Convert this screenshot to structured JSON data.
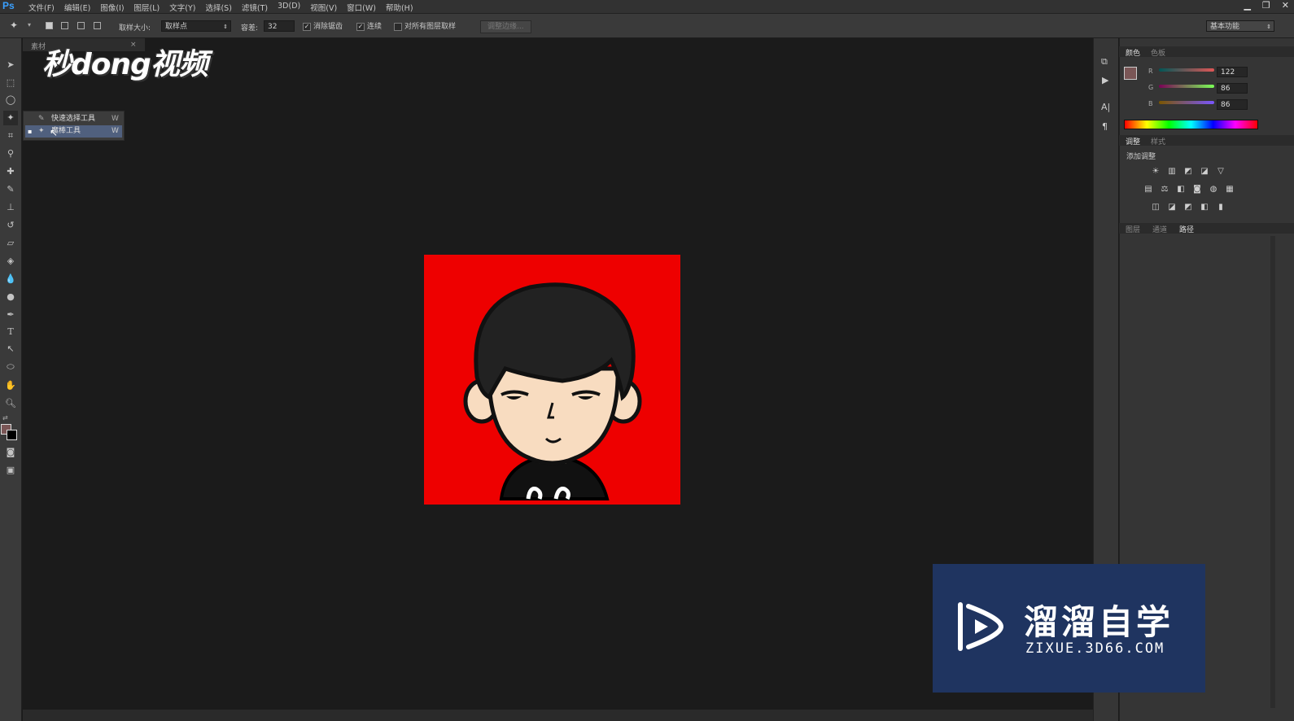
{
  "app": {
    "logo": "Ps"
  },
  "menu": [
    "文件(F)",
    "编辑(E)",
    "图像(I)",
    "图层(L)",
    "文字(Y)",
    "选择(S)",
    "滤镜(T)",
    "3D(D)",
    "视图(V)",
    "窗口(W)",
    "帮助(H)"
  ],
  "window_controls": {
    "minimize": "▁",
    "restore": "❐",
    "close": "✕"
  },
  "options": {
    "sample_size_label": "取样大小:",
    "sample_size_value": "取样点",
    "tolerance_label": "容差:",
    "tolerance_value": "32",
    "antialias_label": "消除锯齿",
    "antialias_checked": true,
    "contiguous_label": "连续",
    "contiguous_checked": true,
    "sample_all_label": "对所有图层取样",
    "sample_all_checked": false,
    "refine_edge_label": "调整边缘...",
    "workspace": "基本功能"
  },
  "doc_tab": {
    "title": "素材",
    "close": "×"
  },
  "watermark_top": "秒dong视频",
  "tool_flyout": [
    {
      "label": "快速选择工具",
      "shortcut": "W",
      "selected": false
    },
    {
      "label": "魔棒工具",
      "shortcut": "W",
      "selected": true
    }
  ],
  "panels": {
    "color_tabs": [
      "颜色",
      "色板"
    ],
    "rgb": [
      {
        "channel": "R",
        "value": "122",
        "color": "#e05050"
      },
      {
        "channel": "G",
        "value": "86",
        "color": "#50c050"
      },
      {
        "channel": "B",
        "value": "86",
        "color": "#6060e0"
      }
    ],
    "foreground_color": "#7a5656",
    "adjust_tabs": [
      "调整",
      "样式"
    ],
    "adjust_title": "添加调整",
    "adjust_icons": [
      [
        "☀",
        "▥",
        "◩",
        "◪",
        "▽"
      ],
      [
        "▤",
        "⚖",
        "◧",
        "◙",
        "◍",
        "▦"
      ],
      [
        "◫",
        "◪",
        "◩",
        "◧",
        "▮"
      ]
    ],
    "layer_tabs": [
      "图层",
      "通道",
      "路径"
    ]
  },
  "zixue": {
    "name": "溜溜自学",
    "url": "ZIXUE.3D66.COM"
  }
}
